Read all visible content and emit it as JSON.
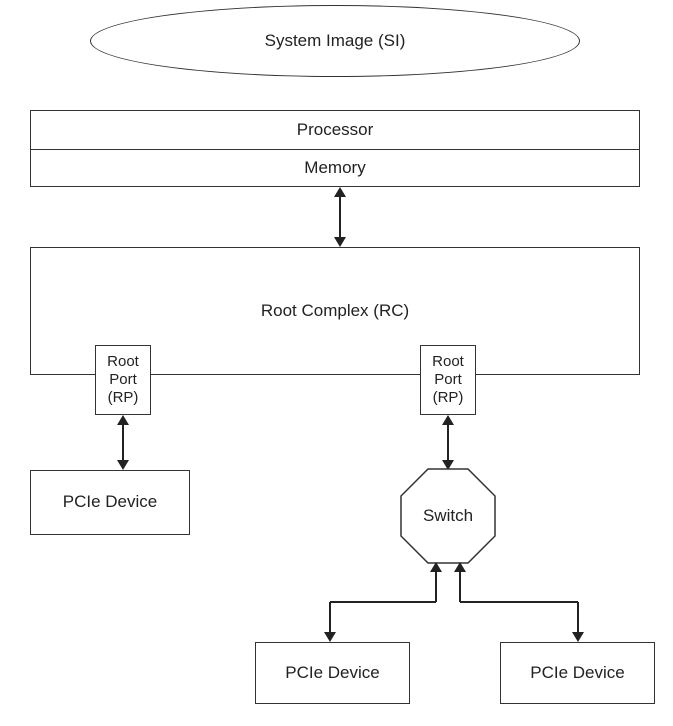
{
  "nodes": {
    "system_image": "System Image (SI)",
    "processor": "Processor",
    "memory": "Memory",
    "root_complex": "Root Complex (RC)",
    "root_port_left": "Root\nPort\n(RP)",
    "root_port_right": "Root\nPort\n(RP)",
    "pcie_left": "PCIe Device",
    "switch": "Switch",
    "pcie_bottom_left": "PCIe Device",
    "pcie_bottom_right": "PCIe Device"
  }
}
